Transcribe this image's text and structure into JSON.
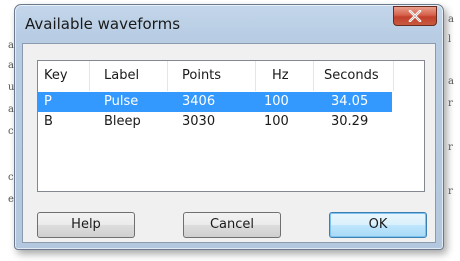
{
  "window": {
    "title": "Available waveforms",
    "close_icon": "close-x-icon",
    "close_color": "#c2402c"
  },
  "background_fragments": {
    "left": [
      "a",
      "a",
      "u",
      "a",
      "c",
      "c",
      "e"
    ],
    "right": [
      "a",
      "l",
      "a",
      "r",
      "r",
      "r"
    ]
  },
  "list": {
    "columns": [
      "Key",
      "Label",
      "Points",
      "Hz",
      "Seconds"
    ],
    "rows": [
      {
        "key": "P",
        "label": "Pulse",
        "points": "3406",
        "hz": "100",
        "seconds": "34.05",
        "selected": true
      },
      {
        "key": "B",
        "label": "Bleep",
        "points": "3030",
        "hz": "100",
        "seconds": "30.29",
        "selected": false
      }
    ],
    "selection_color": "#3399ff"
  },
  "buttons": {
    "help": "Help",
    "cancel": "Cancel",
    "ok": "OK"
  }
}
